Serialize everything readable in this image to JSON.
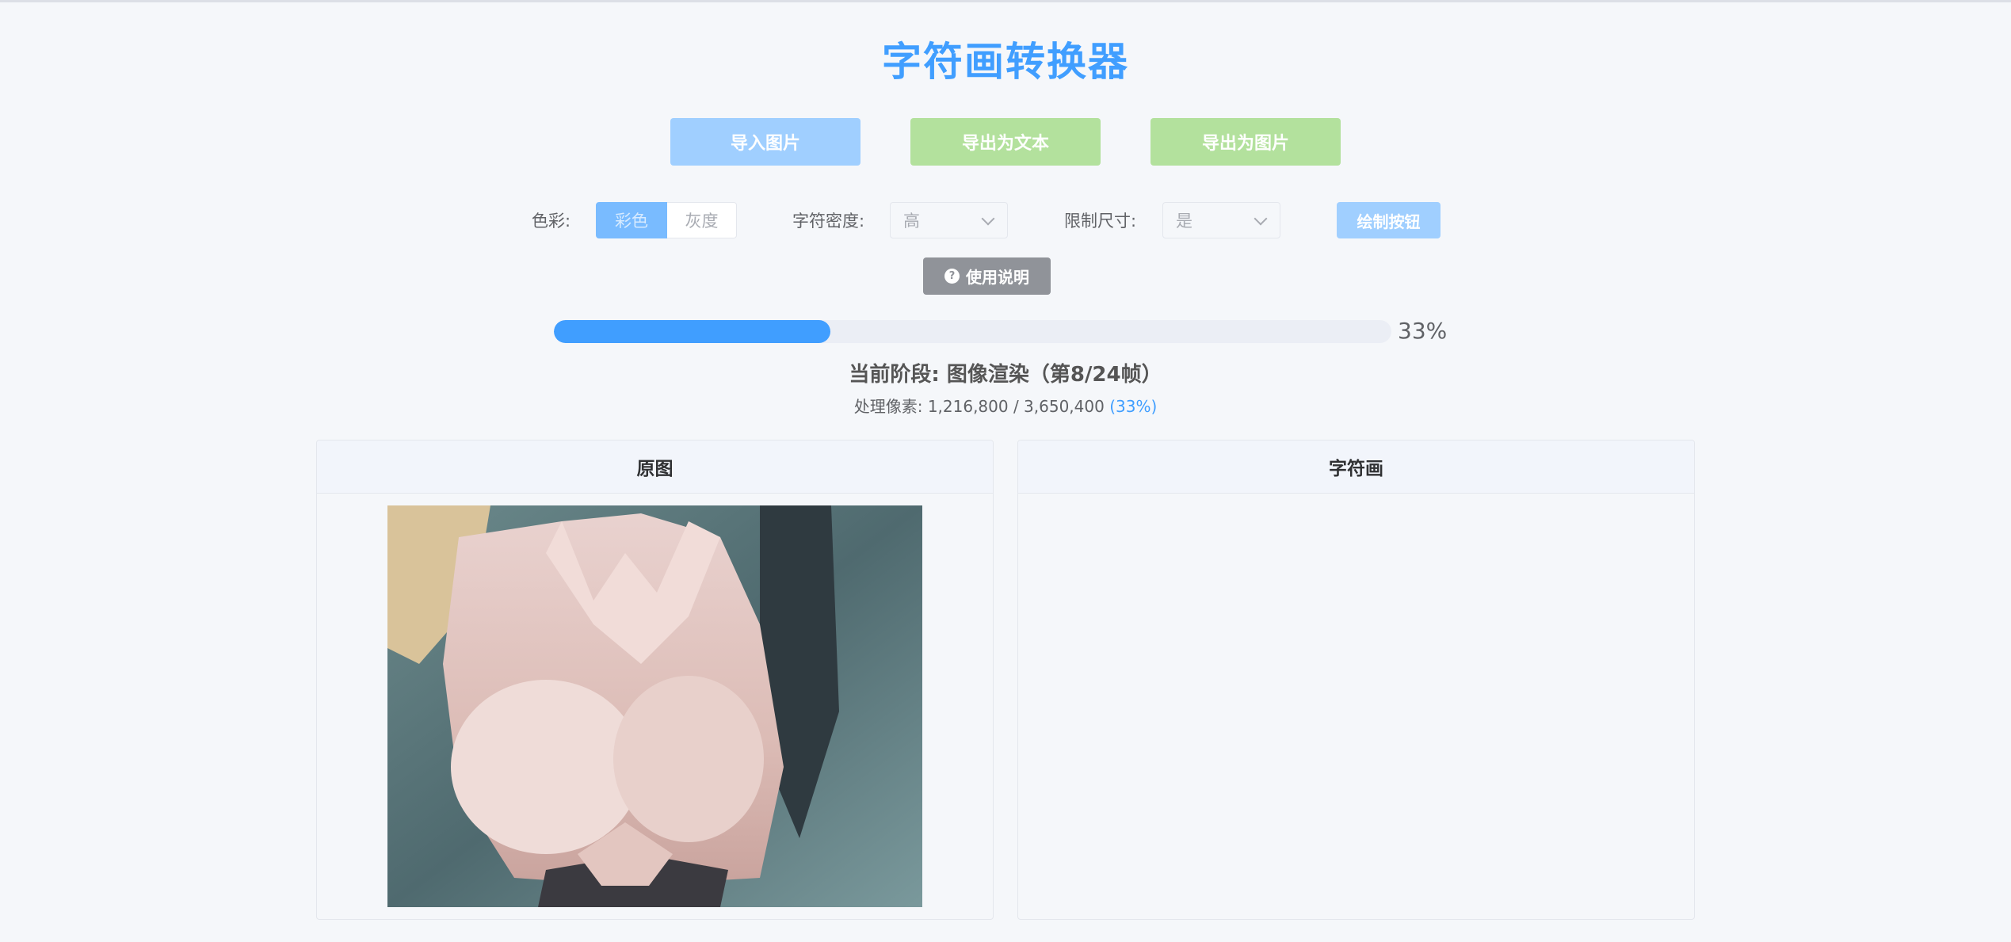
{
  "app": {
    "title": "字符画转换器"
  },
  "toolbar": {
    "import_label": "导入图片",
    "export_text_label": "导出为文本",
    "export_image_label": "导出为图片"
  },
  "options": {
    "color_label": "色彩:",
    "color_mode_color": "彩色",
    "color_mode_gray": "灰度",
    "selected_color_mode": "彩色",
    "density_label": "字符密度:",
    "density_value": "高",
    "limit_label": "限制尺寸:",
    "limit_value": "是",
    "draw_label": "绘制按钮"
  },
  "help": {
    "label": "使用说明",
    "icon": "question-circle-icon"
  },
  "progress": {
    "percent": 33,
    "percent_text": "33%",
    "stage_text": "当前阶段: 图像渲染（第8/24帧）",
    "pixels_text": "处理像素: 1,216,800 / 3,650,400",
    "pixels_pct": "(33%)"
  },
  "panels": {
    "original_title": "原图",
    "ascii_title": "字符画"
  },
  "colors": {
    "primary": "#409eff",
    "primary_light": "#a0cfff",
    "success_light": "#b3e19d",
    "info": "#909399",
    "background": "#f5f7fa"
  }
}
